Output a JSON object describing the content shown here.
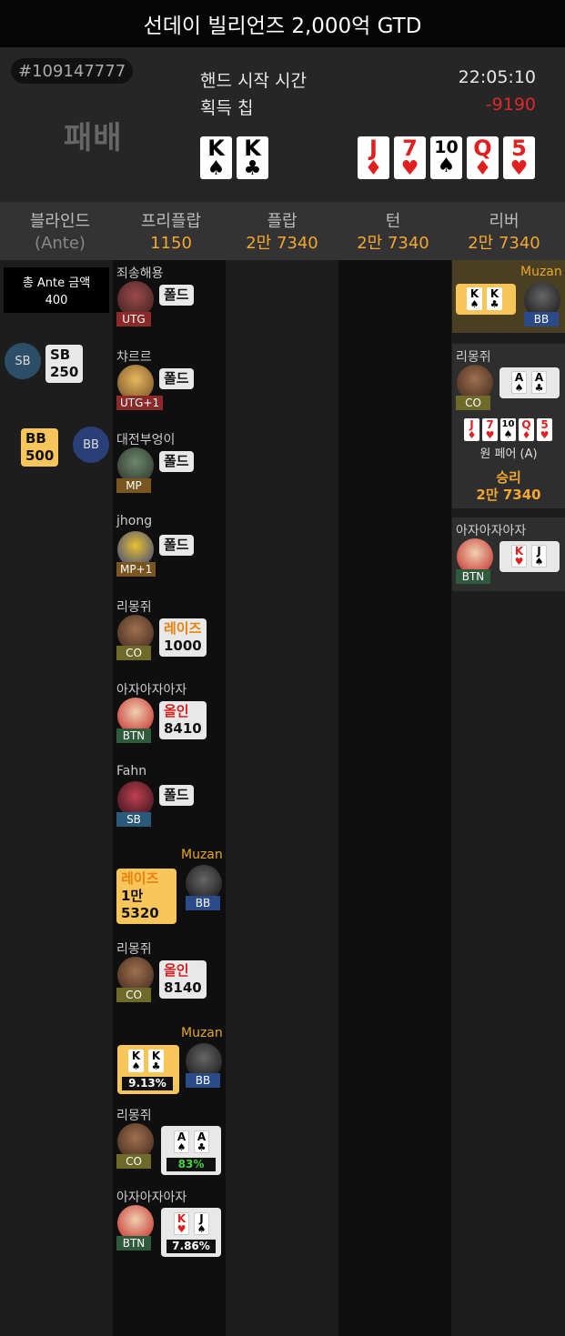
{
  "title": "선데이 빌리언즈 2,000억 GTD",
  "header": {
    "hand_id": "#109147777",
    "result": "패배",
    "start_label": "핸드 시작 시간",
    "start_time": "22:05:10",
    "chips_label": "획득 칩",
    "chips_value": "-9190",
    "hole_cards": [
      {
        "rank": "K",
        "suit": "♠",
        "color": "black"
      },
      {
        "rank": "K",
        "suit": "♣",
        "color": "black"
      }
    ],
    "board": [
      {
        "rank": "J",
        "suit": "♦",
        "color": "red"
      },
      {
        "rank": "7",
        "suit": "♥",
        "color": "red"
      },
      {
        "rank": "10",
        "suit": "♠",
        "color": "black"
      },
      {
        "rank": "Q",
        "suit": "♦",
        "color": "red"
      },
      {
        "rank": "5",
        "suit": "♥",
        "color": "red"
      }
    ]
  },
  "columns": [
    {
      "label": "블라인드",
      "sub": "(Ante)"
    },
    {
      "label": "프리플랍",
      "sub": "1150"
    },
    {
      "label": "플랍",
      "sub": "2만 7340"
    },
    {
      "label": "턴",
      "sub": "2만 7340"
    },
    {
      "label": "리버",
      "sub": "2만 7340"
    }
  ],
  "blinds": {
    "ante_label": "총 Ante 금액",
    "ante_value": "400",
    "sb_label": "SB",
    "sb_value": "250",
    "bb_label": "BB",
    "bb_value": "500"
  },
  "preflop": [
    {
      "name": "죄송해용",
      "pos": "UTG",
      "action": "폴드",
      "amount": ""
    },
    {
      "name": "챠르르",
      "pos": "UTG+1",
      "action": "폴드",
      "amount": ""
    },
    {
      "name": "대전부엉이",
      "pos": "MP",
      "action": "폴드",
      "amount": ""
    },
    {
      "name": "jhong",
      "pos": "MP+1",
      "action": "폴드",
      "amount": ""
    },
    {
      "name": "리몽쥐",
      "pos": "CO",
      "action": "레이즈",
      "amount": "1000"
    },
    {
      "name": "아자아자아자",
      "pos": "BTN",
      "action": "올인",
      "amount": "8410"
    },
    {
      "name": "Fahn",
      "pos": "SB",
      "action": "폴드",
      "amount": ""
    },
    {
      "name": "Muzan",
      "pos": "BB",
      "action": "레이즈",
      "amount_1": "1만",
      "amount_2": "5320"
    },
    {
      "name": "리몽쥐",
      "pos": "CO",
      "action": "올인",
      "amount": "8140"
    }
  ],
  "showdown": [
    {
      "name": "Muzan",
      "pos": "BB",
      "cards": [
        {
          "rank": "K",
          "suit": "♠",
          "color": "black"
        },
        {
          "rank": "K",
          "suit": "♣",
          "color": "black"
        }
      ],
      "equity": "9.13%"
    },
    {
      "name": "리몽쥐",
      "pos": "CO",
      "cards": [
        {
          "rank": "A",
          "suit": "♠",
          "color": "black"
        },
        {
          "rank": "A",
          "suit": "♣",
          "color": "black"
        }
      ],
      "equity": "83%"
    },
    {
      "name": "아자아자아자",
      "pos": "BTN",
      "cards": [
        {
          "rank": "K",
          "suit": "♥",
          "color": "red"
        },
        {
          "rank": "J",
          "suit": "♠",
          "color": "black"
        }
      ],
      "equity": "7.86%"
    }
  ],
  "river": {
    "muzan": {
      "name": "Muzan",
      "pos": "BB"
    },
    "winner": {
      "name": "리몽쥐",
      "pos": "CO",
      "hand": "원 페어 (A)",
      "result": "승리",
      "amount": "2만 7340"
    },
    "btn": {
      "name": "아자아자아자",
      "pos": "BTN"
    }
  }
}
